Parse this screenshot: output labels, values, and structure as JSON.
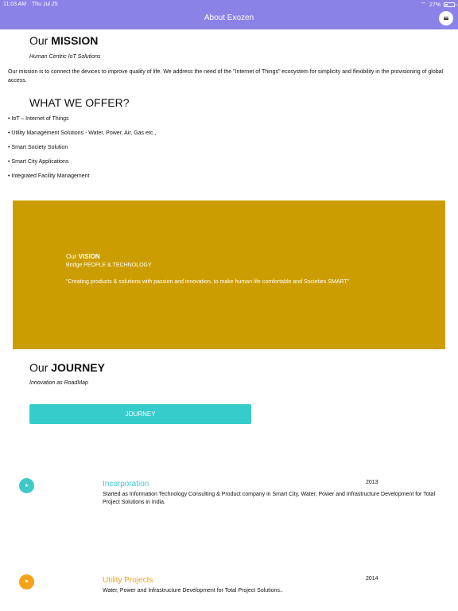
{
  "status_bar": {
    "time": "11:03 AM",
    "date": "Thu Jul 25",
    "battery": "27%"
  },
  "header": {
    "title": "About Exozen"
  },
  "mission": {
    "heading_prefix": "Our",
    "heading_bold": "MISSION",
    "subtitle": "Human Centric IoT Solutions",
    "body": "Our mission is to connect the devices to improve quality of life. We address the need of the \"Internet of Things\" ecosystem for simplicity and flexibility in the provisioning of global access."
  },
  "offer": {
    "heading": "WHAT WE OFFER?",
    "items": [
      "• IoT – Internet of Things",
      "• Utility Management Solutions - Water, Power, Air, Gas etc.,",
      "• Smart Society Solution",
      "• Smart City Applications",
      "• Integrated Facility Management"
    ]
  },
  "vision": {
    "heading_prefix": "Our",
    "heading_bold": "VISION",
    "subtitle": "Bridge PEOPLE & TECHNOLOGY",
    "quote": "\"Creating products & solutions with passion and innovation, to make human life comfortable and Societies SMART\"",
    "bg_color": "#cc9d00"
  },
  "journey": {
    "heading_prefix": "Our",
    "heading_bold": "JOURNEY",
    "subtitle": "Innovation as RoadMap",
    "button_label": "JOURNEY",
    "button_color": "#36cccc"
  },
  "timeline": [
    {
      "title": "Incorporation",
      "year": "2013",
      "description": "Started as Information Technology Consulting & Product company in Smart City, Water, Power and Infrastructure Development for Total Project Solutions in India.",
      "color": "#3fc8c8",
      "icon": "star-icon",
      "glyph": "★"
    },
    {
      "title": "Utility Projects",
      "year": "2014",
      "description": "Water, Power and Infrastructure Development for Total Project Solutions..",
      "color": "#f5a21b",
      "icon": "flag-icon",
      "glyph": "⚑"
    }
  ]
}
